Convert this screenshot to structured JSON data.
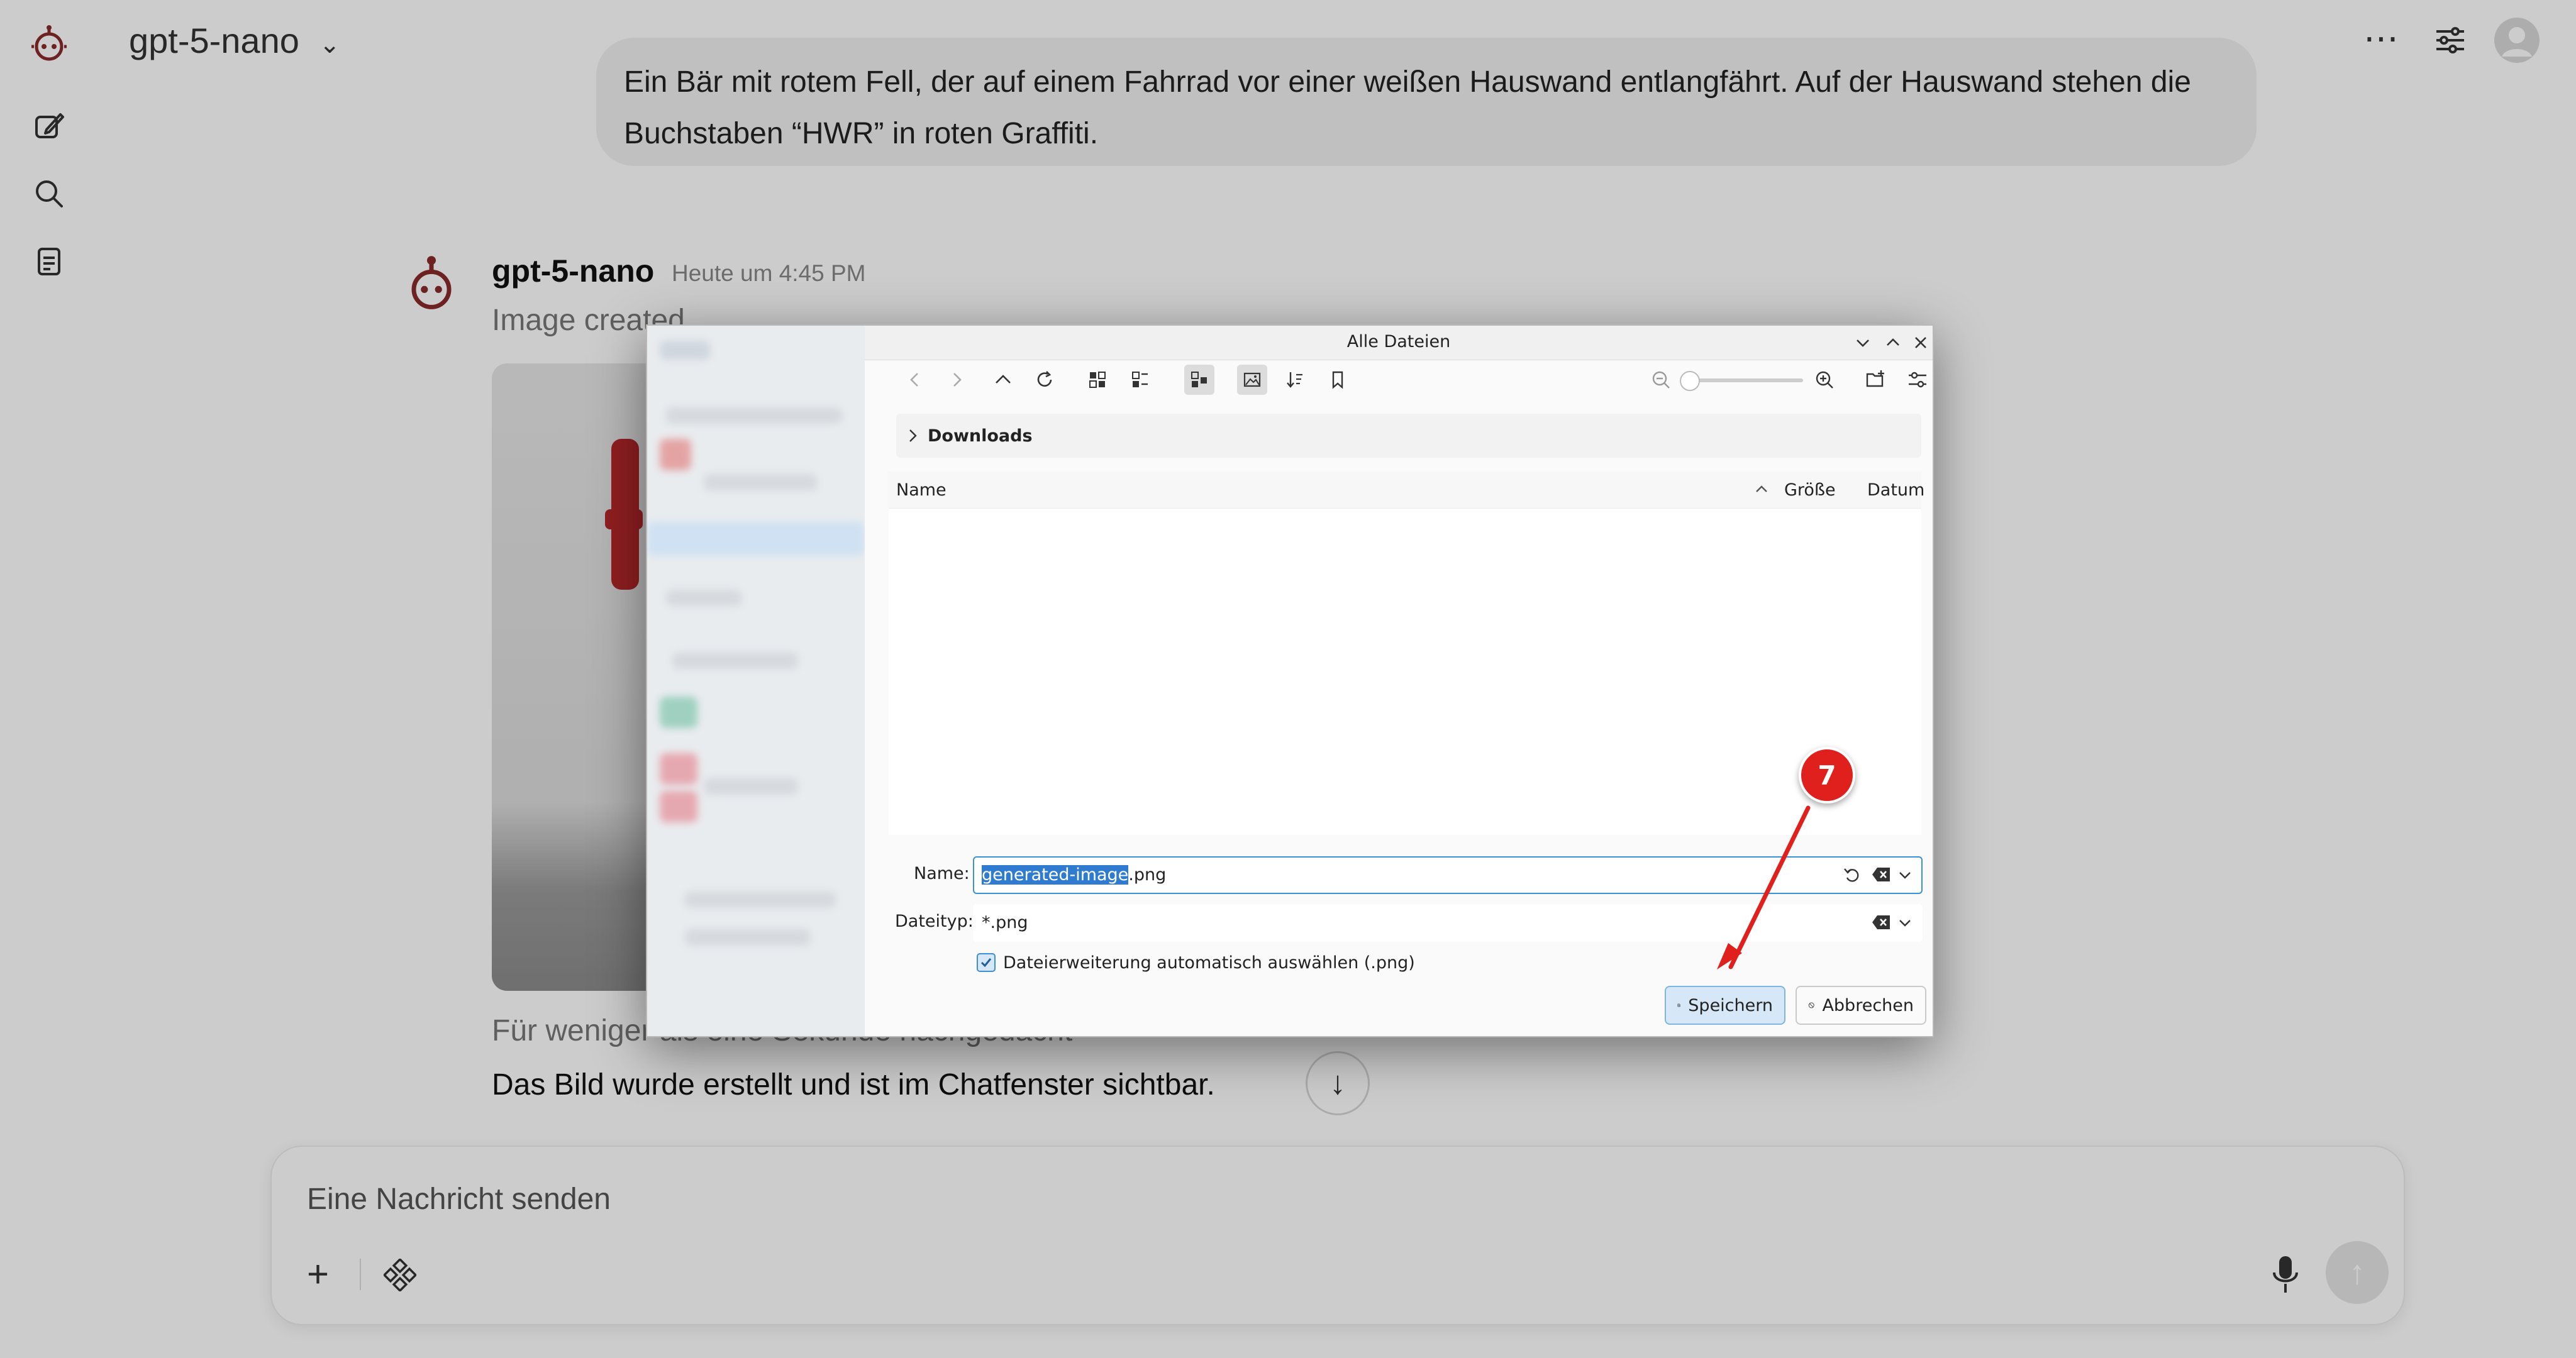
{
  "app": {
    "model_name": "gpt-5-nano",
    "user_message": "Ein Bär mit rotem Fell, der auf einem Fahrrad vor einer weißen Hauswand entlangfährt. Auf der Hauswand stehen die Buchstaben “HWR” in roten Graffiti.",
    "bot_name": "gpt-5-nano",
    "bot_time": "Heute um 4:45 PM",
    "image_status": "Image created",
    "thinking_note": "Für weniger als eine Sekunde nachgedacht",
    "reply": "Das Bild wurde erstellt und ist im Chatfenster sichtbar.",
    "composer_placeholder": "Eine Nachricht senden"
  },
  "dialog": {
    "title": "Alle Dateien",
    "breadcrumb": "Downloads",
    "columns": [
      "Name",
      "Größe",
      "Datum"
    ],
    "name_label": "Name:",
    "filename_selected": "generated-image",
    "filename_rest": ".png",
    "filetype_label": "Dateityp:",
    "filetype_value": "*.png",
    "auto_ext_label": "Dateierweiterung automatisch auswählen (.png)",
    "auto_ext_checked": true,
    "save_label": "Speichern",
    "cancel_label": "Abbrechen"
  },
  "annotation": {
    "step_number": "7",
    "color": "#e0201c"
  }
}
